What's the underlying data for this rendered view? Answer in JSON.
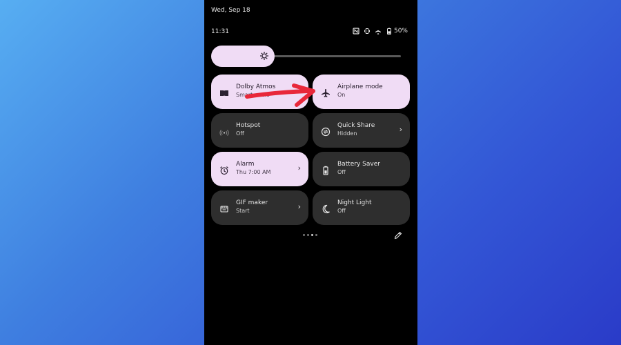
{
  "status": {
    "date": "Wed, Sep 18",
    "time": "11:31",
    "battery": "50%"
  },
  "tiles": [
    {
      "title": "Dolby Atmos",
      "subtitle": "Smart audio",
      "state": "on",
      "icon": "dolby-icon"
    },
    {
      "title": "Airplane mode",
      "subtitle": "On",
      "state": "on",
      "icon": "airplane-icon"
    },
    {
      "title": "Hotspot",
      "subtitle": "Off",
      "state": "off",
      "icon": "hotspot-icon"
    },
    {
      "title": "Quick Share",
      "subtitle": "Hidden",
      "state": "off",
      "icon": "quick-share-icon"
    },
    {
      "title": "Alarm",
      "subtitle": "Thu 7:00 AM",
      "state": "on",
      "icon": "alarm-icon"
    },
    {
      "title": "Battery Saver",
      "subtitle": "Off",
      "state": "off",
      "icon": "battery-saver-icon"
    },
    {
      "title": "GIF maker",
      "subtitle": "Start",
      "state": "off",
      "icon": "gif-icon"
    },
    {
      "title": "Night Light",
      "subtitle": "Off",
      "state": "off",
      "icon": "night-light-icon"
    }
  ],
  "colors": {
    "tile_on": "#f0dcf5",
    "tile_off": "#2e2e2e",
    "annotation_arrow": "#e8283a"
  }
}
